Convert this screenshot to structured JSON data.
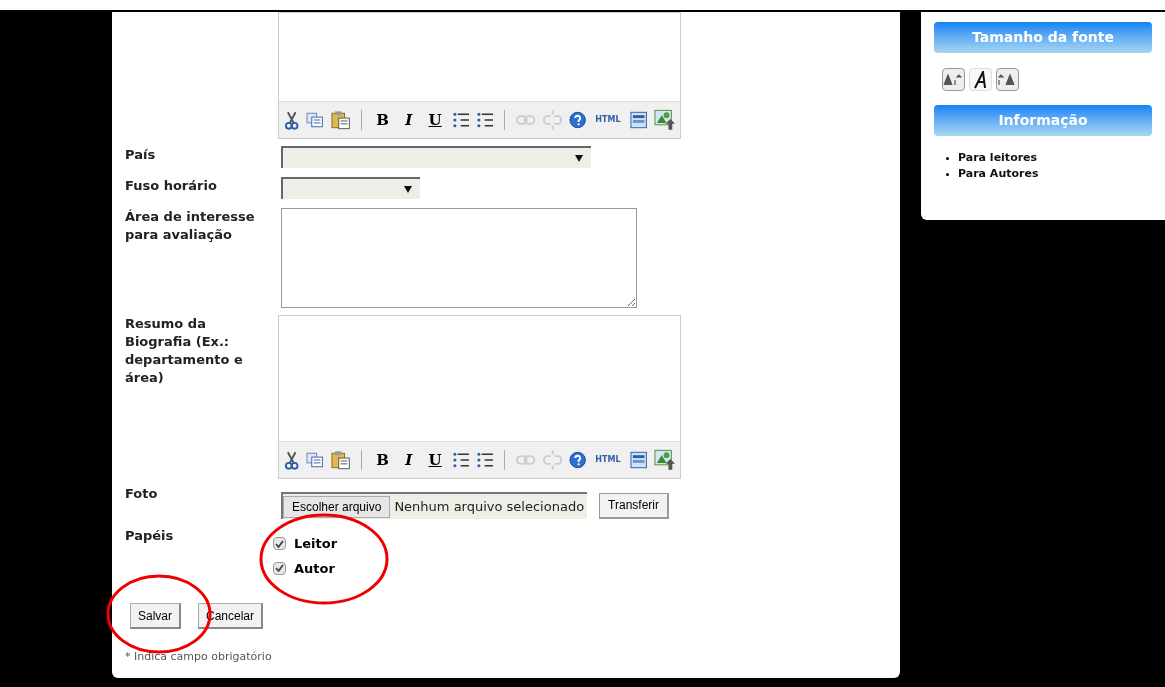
{
  "form": {
    "top_editor": {
      "toolbar": [
        {
          "kind": "cut"
        },
        {
          "kind": "copy"
        },
        {
          "kind": "paste"
        },
        {
          "kind": "sep"
        },
        {
          "kind": "bold",
          "label": "B"
        },
        {
          "kind": "italic",
          "label": "I"
        },
        {
          "kind": "underline",
          "label": "U"
        },
        {
          "kind": "bullets"
        },
        {
          "kind": "numbers"
        },
        {
          "kind": "sep"
        },
        {
          "kind": "link",
          "disabled": true
        },
        {
          "kind": "unlink",
          "disabled": true
        },
        {
          "kind": "help"
        },
        {
          "kind": "html",
          "label": "HTML"
        },
        {
          "kind": "window"
        },
        {
          "kind": "image"
        }
      ]
    },
    "country": {
      "label": "País"
    },
    "timezone": {
      "label": "Fuso horário"
    },
    "interest": {
      "label": "Área de interesse para avaliação"
    },
    "bio": {
      "label": "Resumo da Biografia (Ex.: departamento e área)",
      "toolbar": [
        {
          "kind": "cut"
        },
        {
          "kind": "copy"
        },
        {
          "kind": "paste"
        },
        {
          "kind": "sep"
        },
        {
          "kind": "bold",
          "label": "B"
        },
        {
          "kind": "italic",
          "label": "I"
        },
        {
          "kind": "underline",
          "label": "U"
        },
        {
          "kind": "bullets"
        },
        {
          "kind": "numbers"
        },
        {
          "kind": "sep"
        },
        {
          "kind": "link",
          "disabled": true
        },
        {
          "kind": "unlink",
          "disabled": true
        },
        {
          "kind": "help"
        },
        {
          "kind": "html",
          "label": "HTML"
        },
        {
          "kind": "window"
        },
        {
          "kind": "image"
        }
      ]
    },
    "photo": {
      "label": "Foto",
      "choose_button": "Escolher arquivo",
      "file_status": "Nenhum arquivo selecionado",
      "upload_button": "Transferir"
    },
    "roles": {
      "label": "Papéis",
      "options": [
        {
          "label": "Leitor",
          "checked": true
        },
        {
          "label": "Autor",
          "checked": true
        }
      ]
    },
    "buttons": [
      "Salvar",
      "Cancelar"
    ],
    "footnote": "* Indica campo obrigatório"
  },
  "sidebar": {
    "font_size": {
      "title": "Tamanho da fonte"
    },
    "info": {
      "title": "Informação",
      "links": [
        "Para leitores",
        "Para Autores"
      ]
    }
  }
}
